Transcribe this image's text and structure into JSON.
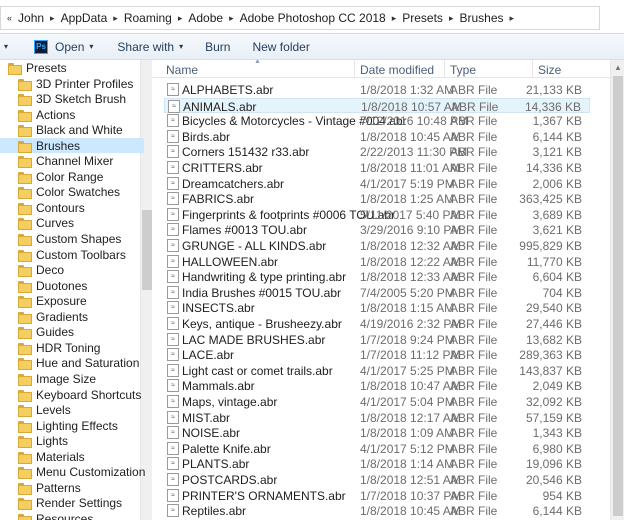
{
  "address": {
    "crumbs": [
      "John",
      "AppData",
      "Roaming",
      "Adobe",
      "Adobe Photoshop CC 2018",
      "Presets",
      "Brushes"
    ]
  },
  "toolbar": {
    "open_label": "Open",
    "share_label": "Share with",
    "burn_label": "Burn",
    "new_folder_label": "New folder"
  },
  "nav": {
    "root": "Presets",
    "items": [
      "3D Printer Profiles",
      "3D Sketch Brush",
      "Actions",
      "Black and White",
      "Brushes",
      "Channel Mixer",
      "Color Range",
      "Color Swatches",
      "Contours",
      "Curves",
      "Custom Shapes",
      "Custom Toolbars",
      "Deco",
      "Duotones",
      "Exposure",
      "Gradients",
      "Guides",
      "HDR Toning",
      "Hue and Saturation",
      "Image Size",
      "Keyboard Shortcuts",
      "Levels",
      "Lighting Effects",
      "Lights",
      "Materials",
      "Menu Customization",
      "Patterns",
      "Render Settings",
      "Resources"
    ],
    "selected": "Brushes"
  },
  "columns": {
    "name": "Name",
    "date": "Date modified",
    "type": "Type",
    "size": "Size"
  },
  "files": [
    {
      "name": "ALPHABETS.abr",
      "date": "1/8/2018 1:32 AM",
      "type": "ABR File",
      "size": "21,133 KB"
    },
    {
      "name": "ANIMALS.abr",
      "date": "1/8/2018 10:57 AM",
      "type": "ABR File",
      "size": "14,336 KB"
    },
    {
      "name": "Bicycles & Motorcycles - Vintage #004.abr",
      "date": "7/12/2016 10:48 PM",
      "type": "ABR File",
      "size": "1,367 KB"
    },
    {
      "name": "Birds.abr",
      "date": "1/8/2018 10:45 AM",
      "type": "ABR File",
      "size": "6,144 KB"
    },
    {
      "name": "Corners 151432 r33.abr",
      "date": "2/22/2013 11:30 PM",
      "type": "ABR File",
      "size": "3,121 KB"
    },
    {
      "name": "CRITTERS.abr",
      "date": "1/8/2018 11:01 AM",
      "type": "ABR File",
      "size": "14,336 KB"
    },
    {
      "name": "Dreamcatchers.abr",
      "date": "4/1/2017 5:19 PM",
      "type": "ABR File",
      "size": "2,006 KB"
    },
    {
      "name": "FABRICS.abr",
      "date": "1/8/2018 1:25 AM",
      "type": "ABR File",
      "size": "363,425 KB"
    },
    {
      "name": "Fingerprints & footprints #0006 TOU.abr",
      "date": "5/11/2017 5:40 PM",
      "type": "ABR File",
      "size": "3,689 KB"
    },
    {
      "name": "Flames #0013 TOU.abr",
      "date": "3/29/2016 9:10 PM",
      "type": "ABR File",
      "size": "3,621 KB"
    },
    {
      "name": "GRUNGE - ALL KINDS.abr",
      "date": "1/8/2018 12:32 AM",
      "type": "ABR File",
      "size": "995,829 KB"
    },
    {
      "name": "HALLOWEEN.abr",
      "date": "1/8/2018 12:22 AM",
      "type": "ABR File",
      "size": "11,770 KB"
    },
    {
      "name": "Handwriting & type printing.abr",
      "date": "1/8/2018 12:33 AM",
      "type": "ABR File",
      "size": "6,604 KB"
    },
    {
      "name": "India Brushes #0015 TOU.abr",
      "date": "7/4/2005 5:20 PM",
      "type": "ABR File",
      "size": "704 KB"
    },
    {
      "name": "INSECTS.abr",
      "date": "1/8/2018 1:15 AM",
      "type": "ABR File",
      "size": "29,540 KB"
    },
    {
      "name": "Keys, antique - Brusheezy.abr",
      "date": "4/19/2016 2:32 PM",
      "type": "ABR File",
      "size": "27,446 KB"
    },
    {
      "name": "LAC MADE BRUSHES.abr",
      "date": "1/7/2018 9:24 PM",
      "type": "ABR File",
      "size": "13,682 KB"
    },
    {
      "name": "LACE.abr",
      "date": "1/7/2018 11:12 PM",
      "type": "ABR File",
      "size": "289,363 KB"
    },
    {
      "name": "Light cast or comet trails.abr",
      "date": "4/1/2017 5:25 PM",
      "type": "ABR File",
      "size": "143,837 KB"
    },
    {
      "name": "Mammals.abr",
      "date": "1/8/2018 10:47 AM",
      "type": "ABR File",
      "size": "2,049 KB"
    },
    {
      "name": "Maps, vintage.abr",
      "date": "4/1/2017 5:04 PM",
      "type": "ABR File",
      "size": "32,092 KB"
    },
    {
      "name": "MIST.abr",
      "date": "1/8/2018 12:17 AM",
      "type": "ABR File",
      "size": "57,159 KB"
    },
    {
      "name": "NOISE.abr",
      "date": "1/8/2018 1:09 AM",
      "type": "ABR File",
      "size": "1,343 KB"
    },
    {
      "name": "Palette Knife.abr",
      "date": "4/1/2017 5:12 PM",
      "type": "ABR File",
      "size": "6,980 KB"
    },
    {
      "name": "PLANTS.abr",
      "date": "1/8/2018 1:14 AM",
      "type": "ABR File",
      "size": "19,096 KB"
    },
    {
      "name": "POSTCARDS.abr",
      "date": "1/8/2018 12:51 AM",
      "type": "ABR File",
      "size": "20,546 KB"
    },
    {
      "name": "PRINTER'S ORNAMENTS.abr",
      "date": "1/7/2018 10:37 PM",
      "type": "ABR File",
      "size": "954 KB"
    },
    {
      "name": "Reptiles.abr",
      "date": "1/8/2018 10:45 AM",
      "type": "ABR File",
      "size": "6,144 KB"
    }
  ],
  "highlighted_file": "ANIMALS.abr",
  "colors": {
    "selection": "#cce8ff",
    "hover": "#e5f3fb",
    "folder": "#f4cf5f",
    "header_text": "#4c607a"
  }
}
